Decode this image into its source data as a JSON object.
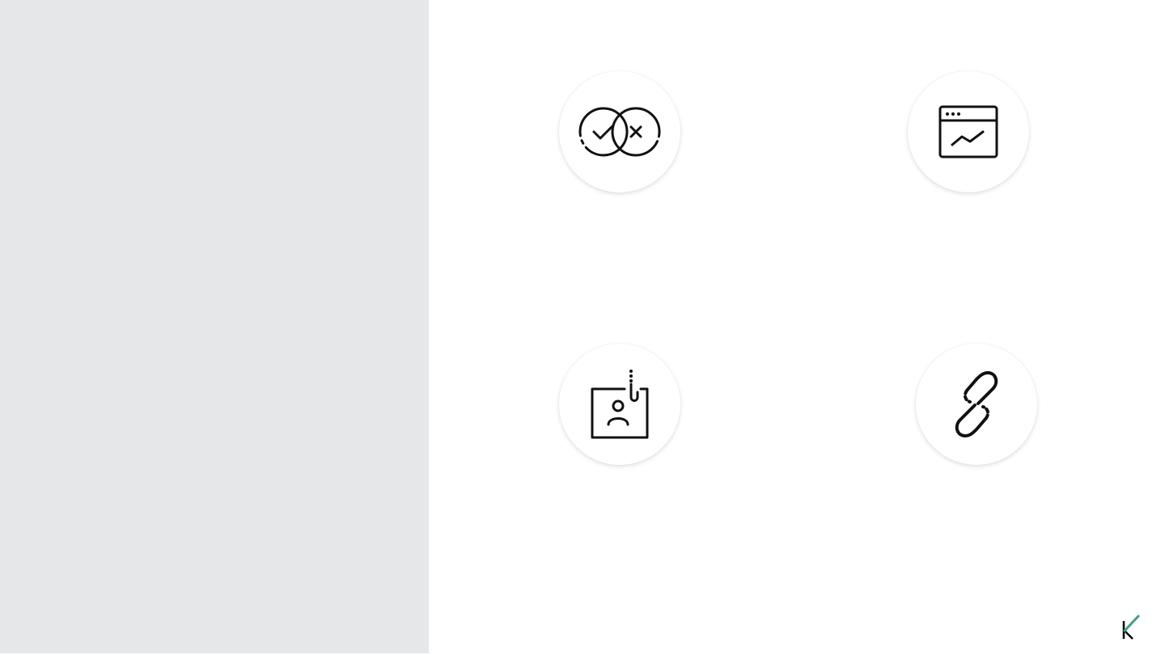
{
  "slide": {
    "left_panel_color": "#e6e7e9",
    "background_color": "#ffffff"
  },
  "icons": [
    {
      "name": "check-and-cross-circles-icon"
    },
    {
      "name": "browser-window-chart-icon"
    },
    {
      "name": "phishing-hook-id-card-icon"
    },
    {
      "name": "broken-chain-link-icon"
    }
  ],
  "logo": {
    "name": "kaspersky-k-logo",
    "accent_color": "#3fa07e",
    "letter_color": "#000000"
  }
}
